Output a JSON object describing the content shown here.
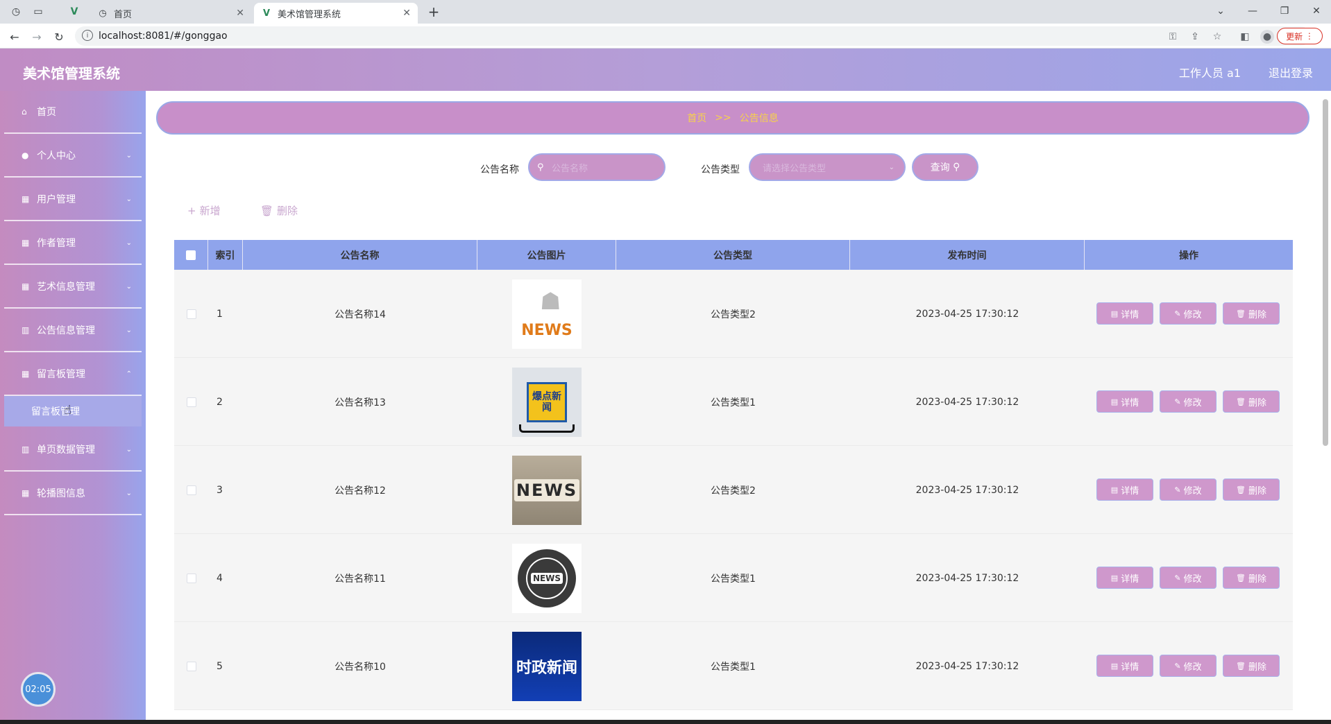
{
  "browser": {
    "tabs": [
      {
        "label": "首页"
      },
      {
        "label": "美术馆管理系统"
      }
    ],
    "url": "localhost:8081/#/gonggao",
    "update_label": "更新"
  },
  "header": {
    "title": "美术馆管理系统",
    "user": "工作人员 a1",
    "logout": "退出登录"
  },
  "sidebar": {
    "items": [
      {
        "label": "首页",
        "icon": "home-icon"
      },
      {
        "label": "个人中心",
        "icon": "person-icon"
      },
      {
        "label": "用户管理",
        "icon": "grid-icon"
      },
      {
        "label": "作者管理",
        "icon": "grid-icon"
      },
      {
        "label": "艺术信息管理",
        "icon": "grid-icon"
      },
      {
        "label": "公告信息管理",
        "icon": "chart-icon"
      },
      {
        "label": "留言板管理",
        "icon": "grid-icon"
      },
      {
        "label": "单页数据管理",
        "icon": "grid-icon"
      },
      {
        "label": "轮播图信息",
        "icon": "grid-icon"
      }
    ],
    "sub_item": "留言板管理",
    "clock": "02:05"
  },
  "breadcrumb": {
    "home": "首页",
    "sep": ">>",
    "current": "公告信息"
  },
  "search": {
    "name_label": "公告名称",
    "name_placeholder": "公告名称",
    "type_label": "公告类型",
    "type_placeholder": "请选择公告类型",
    "query_label": "查询"
  },
  "toolbar": {
    "add": "新增",
    "delete": "删除"
  },
  "table": {
    "headers": [
      "索引",
      "公告名称",
      "公告图片",
      "公告类型",
      "发布时间",
      "操作"
    ],
    "actions": {
      "detail": "详情",
      "edit": "修改",
      "delete": "删除"
    },
    "rows": [
      {
        "index": "1",
        "name": "公告名称14",
        "image": "NEWS",
        "type": "公告类型2",
        "time": "2023-04-25 17:30:12"
      },
      {
        "index": "2",
        "name": "公告名称13",
        "image": "爆点新闻",
        "type": "公告类型1",
        "time": "2023-04-25 17:30:12"
      },
      {
        "index": "3",
        "name": "公告名称12",
        "image": "NEWS",
        "type": "公告类型2",
        "time": "2023-04-25 17:30:12"
      },
      {
        "index": "4",
        "name": "公告名称11",
        "image": "NEWS",
        "type": "公告类型1",
        "time": "2023-04-25 17:30:12"
      },
      {
        "index": "5",
        "name": "公告名称10",
        "image": "时政新闻",
        "type": "公告类型1",
        "time": "2023-04-25 17:30:12"
      }
    ]
  },
  "colors": {
    "accent": "#c994c8",
    "header_blue": "#8fa4ec",
    "breadcrumb_text": "#f7d24a"
  }
}
